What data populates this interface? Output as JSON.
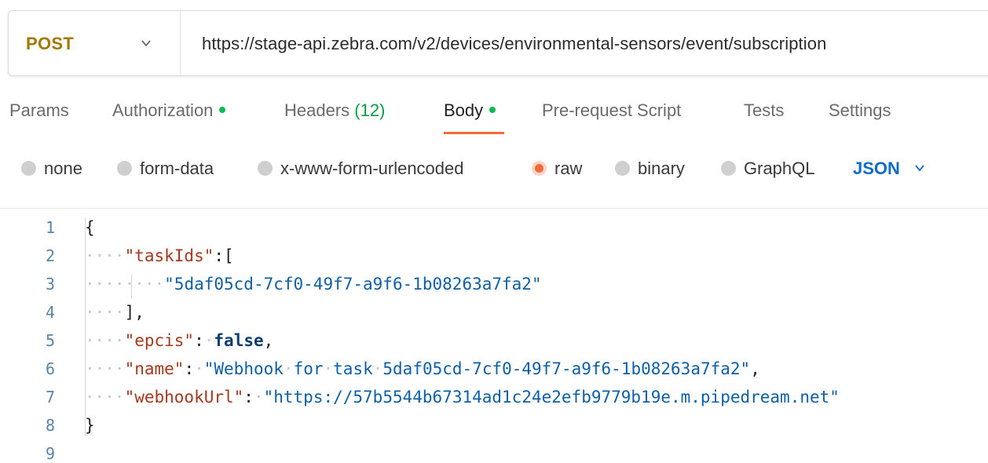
{
  "request": {
    "method": "POST",
    "url": "https://stage-api.zebra.com/v2/devices/environmental-sensors/event/subscription"
  },
  "tabs": [
    {
      "label": "Params"
    },
    {
      "label": "Authorization"
    },
    {
      "label": "Headers",
      "count": "(12)"
    },
    {
      "label": "Body"
    },
    {
      "label": "Pre-request Script"
    },
    {
      "label": "Tests"
    },
    {
      "label": "Settings"
    }
  ],
  "active_tab": "Body",
  "body_types": [
    {
      "label": "none"
    },
    {
      "label": "form-data"
    },
    {
      "label": "x-www-form-urlencoded"
    },
    {
      "label": "raw"
    },
    {
      "label": "binary"
    },
    {
      "label": "GraphQL"
    }
  ],
  "selected_body_type": "raw",
  "language": "JSON",
  "colors": {
    "accent": "#f26b3a",
    "method": "#a37700",
    "language": "#0f6bc7",
    "indicator": "#0cbb52"
  },
  "editor": {
    "line_numbers": [
      "1",
      "2",
      "3",
      "4",
      "5",
      "6",
      "7",
      "8",
      "9"
    ],
    "lines": [
      {
        "tokens": [
          {
            "t": "{",
            "c": "punc"
          }
        ]
      },
      {
        "tokens": [
          {
            "t": "····",
            "c": "ws"
          },
          {
            "t": "\"taskIds\"",
            "c": "key"
          },
          {
            "t": ":[",
            "c": "punc"
          }
        ]
      },
      {
        "tokens": [
          {
            "t": "········",
            "c": "ws"
          },
          {
            "t": "\"5daf05cd-7cf0-49f7-a9f6-1b08263a7fa2\"",
            "c": "str"
          }
        ]
      },
      {
        "tokens": [
          {
            "t": "····",
            "c": "ws"
          },
          {
            "t": "],",
            "c": "punc"
          }
        ]
      },
      {
        "tokens": [
          {
            "t": "····",
            "c": "ws"
          },
          {
            "t": "\"epcis\"",
            "c": "key"
          },
          {
            "t": ":",
            "c": "punc"
          },
          {
            "t": "·",
            "c": "ws"
          },
          {
            "t": "false",
            "c": "kw"
          },
          {
            "t": ",",
            "c": "punc"
          }
        ]
      },
      {
        "tokens": [
          {
            "t": "····",
            "c": "ws"
          },
          {
            "t": "\"name\"",
            "c": "key"
          },
          {
            "t": ":",
            "c": "punc"
          },
          {
            "t": "·",
            "c": "ws"
          },
          {
            "t": "\"Webhook",
            "c": "str"
          },
          {
            "t": "·",
            "c": "ws"
          },
          {
            "t": "for",
            "c": "str"
          },
          {
            "t": "·",
            "c": "ws"
          },
          {
            "t": "task",
            "c": "str"
          },
          {
            "t": "·",
            "c": "ws"
          },
          {
            "t": "5daf05cd-7cf0-49f7-a9f6-1b08263a7fa2\"",
            "c": "str"
          },
          {
            "t": ",",
            "c": "punc"
          }
        ]
      },
      {
        "tokens": [
          {
            "t": "····",
            "c": "ws"
          },
          {
            "t": "\"webhookUrl\"",
            "c": "key"
          },
          {
            "t": ":",
            "c": "punc"
          },
          {
            "t": "·",
            "c": "ws"
          },
          {
            "t": "\"https://57b5544b67314ad1c24e2efb9779b19e.m.pipedream.net\"",
            "c": "str"
          }
        ]
      },
      {
        "tokens": [
          {
            "t": "}",
            "c": "punc"
          }
        ]
      },
      {
        "tokens": []
      }
    ]
  }
}
